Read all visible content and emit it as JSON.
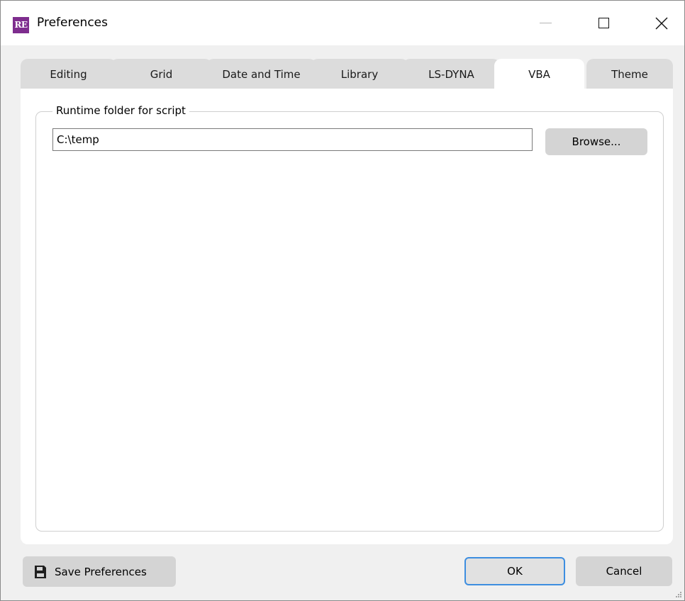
{
  "window": {
    "title": "Preferences",
    "app_icon_text": "RE",
    "controls": [
      "minimize-icon",
      "maximize-icon",
      "close-icon"
    ],
    "close_glyph": "✕"
  },
  "tabs": [
    {
      "label": "Editing",
      "active": false
    },
    {
      "label": "Grid",
      "active": false
    },
    {
      "label": "Date and Time",
      "active": false
    },
    {
      "label": "Library",
      "active": false
    },
    {
      "label": "LS-DYNA",
      "active": false
    },
    {
      "label": "VBA",
      "active": true
    },
    {
      "label": "Theme",
      "active": false
    }
  ],
  "vba": {
    "group_title": "Runtime folder for script",
    "folder_value": "C:\\temp",
    "browse_label": "Browse..."
  },
  "footer": {
    "save_label": "Save Preferences",
    "ok_label": "OK",
    "cancel_label": "Cancel"
  },
  "colors": {
    "app_icon_bg": "#7e2d8e",
    "ok_focus_border": "#3d8ee0",
    "button_bg": "#d4d4d4",
    "inactive_tab_bg": "#dcdcdc"
  }
}
